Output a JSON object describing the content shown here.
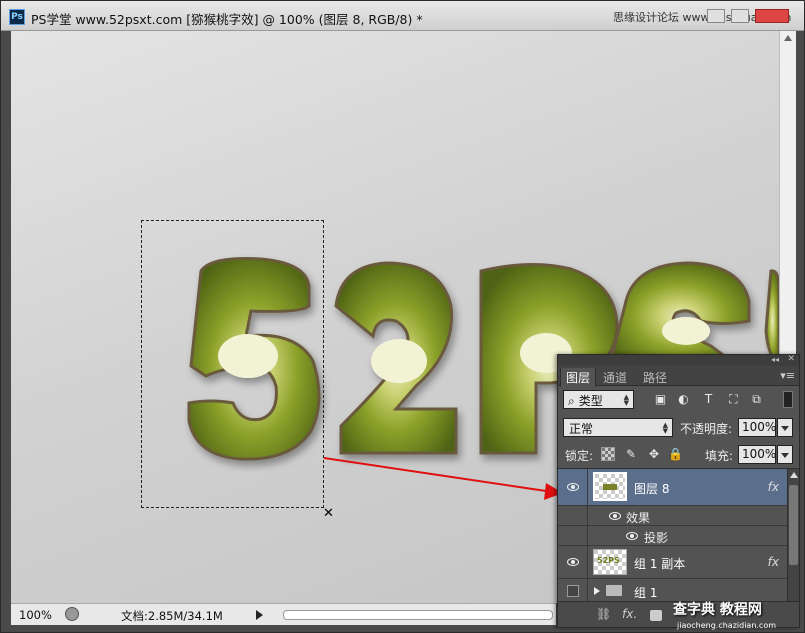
{
  "window": {
    "title": "PS学堂 www.52psxt.com [猕猴桃字效] @ 100% (图层 8, RGB/8) *",
    "logo": "Ps"
  },
  "canvas": {
    "letters": "52PS"
  },
  "statusbar": {
    "zoom": "100%",
    "doc_info": "文档:2.85M/34.1M"
  },
  "layers_panel": {
    "tabs": [
      "图层",
      "通道",
      "路径"
    ],
    "filter_kind": "类型",
    "blend_mode": "正常",
    "opacity_label": "不透明度:",
    "opacity_value": "100%",
    "lock_label": "锁定:",
    "fill_label": "填充:",
    "fill_value": "100%",
    "layers": [
      {
        "name": "图层 8",
        "fx": "fx",
        "selected": true
      },
      {
        "name": "效果"
      },
      {
        "name": "投影"
      },
      {
        "name": "组 1 副本",
        "fx": "fx",
        "thumb_text": "52PS"
      },
      {
        "name": "组 1"
      }
    ],
    "bottom_fx": "fx."
  },
  "watermarks": {
    "top": "思缘设计论坛 www.missyuan.com",
    "bottom": "查字典 教程网",
    "bottom_sub": "jiaocheng.chazidian.com"
  }
}
